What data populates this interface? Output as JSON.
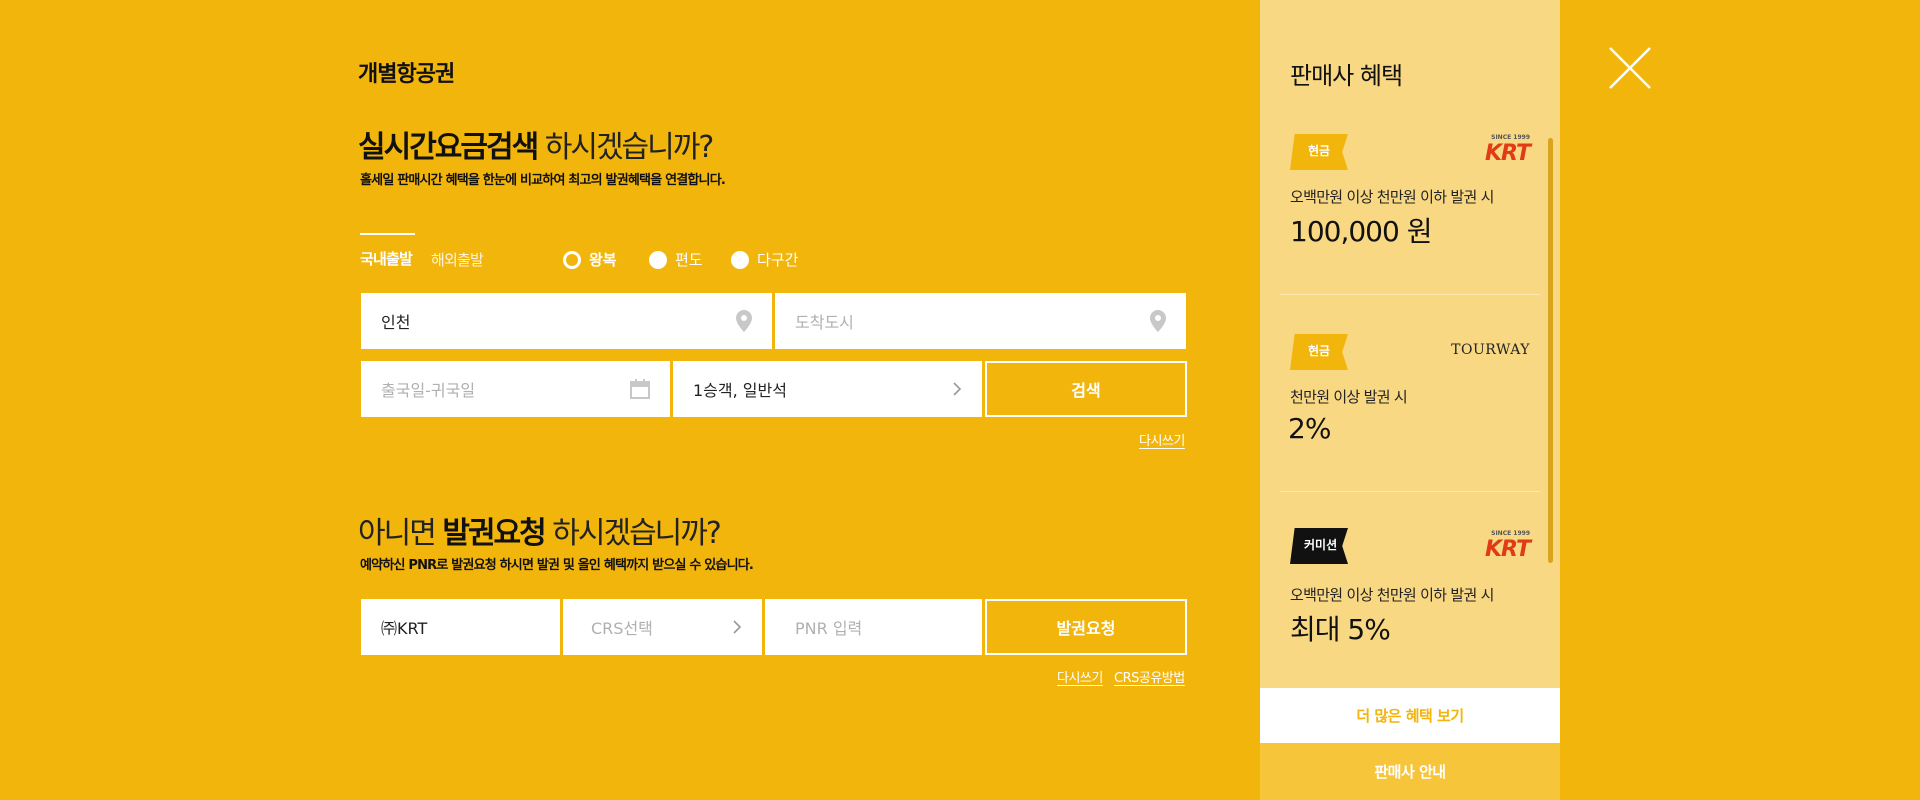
{
  "section_title": "개별항공권",
  "search": {
    "heading_bold": "실시간요금검색",
    "heading_light": " 하시겠습니까?",
    "subtext": "홀세일 판매시간 혜택을 한눈에 비교하여 최고의 발권혜택을 연결합니다.",
    "tabs": [
      {
        "label": "국내출발",
        "active": true
      },
      {
        "label": "해외출발",
        "active": false
      }
    ],
    "trip_types": [
      {
        "label": "왕복",
        "selected": true
      },
      {
        "label": "편도",
        "selected": false
      },
      {
        "label": "다구간",
        "selected": false
      }
    ],
    "departure_value": "인천",
    "arrival_placeholder": "도착도시",
    "date_placeholder": "출국일-귀국일",
    "passenger_value": "1승객, 일반석",
    "search_label": "검색",
    "reset_label": "다시쓰기"
  },
  "issue": {
    "heading_pre": "아니면 ",
    "heading_bold": "발권요청",
    "heading_post": " 하시겠습니까?",
    "subtext": "예약하신 PNR로 발권요청 하시면 발권 및 올인 혜택까지 받으실 수 있습니다.",
    "agency_value": "㈜KRT",
    "crs_placeholder": "CRS선택",
    "pnr_placeholder": "PNR 입력",
    "request_label": "발권요청",
    "reset_label": "다시쓰기",
    "crs_guide_label": "CRS공유방법"
  },
  "benefits": {
    "title": "판매사 혜택",
    "items": [
      {
        "badge": "현금",
        "badge_color": "#f2b50c",
        "logo": "KRT",
        "logo_sub": "SINCE 1999",
        "condition": "오백만원 이상 천만원 이하 발권 시",
        "amount": "100,000 원"
      },
      {
        "badge": "현금",
        "badge_color": "#f2b50c",
        "logo": "TOURWAY",
        "logo_sub": "",
        "condition": "천만원 이상 발권 시",
        "amount": "2%"
      },
      {
        "badge": "커미션",
        "badge_color": "#111111",
        "logo": "KRT",
        "logo_sub": "SINCE 1999",
        "condition": "오백만원 이상 천만원 이하 발권 시",
        "amount": "최대 5%"
      }
    ],
    "more_label": "더 많은 혜택 보기",
    "guide_label": "판매사 안내"
  },
  "colors": {
    "background": "#f2b50c",
    "panel": "#f9d883",
    "white": "#ffffff"
  }
}
